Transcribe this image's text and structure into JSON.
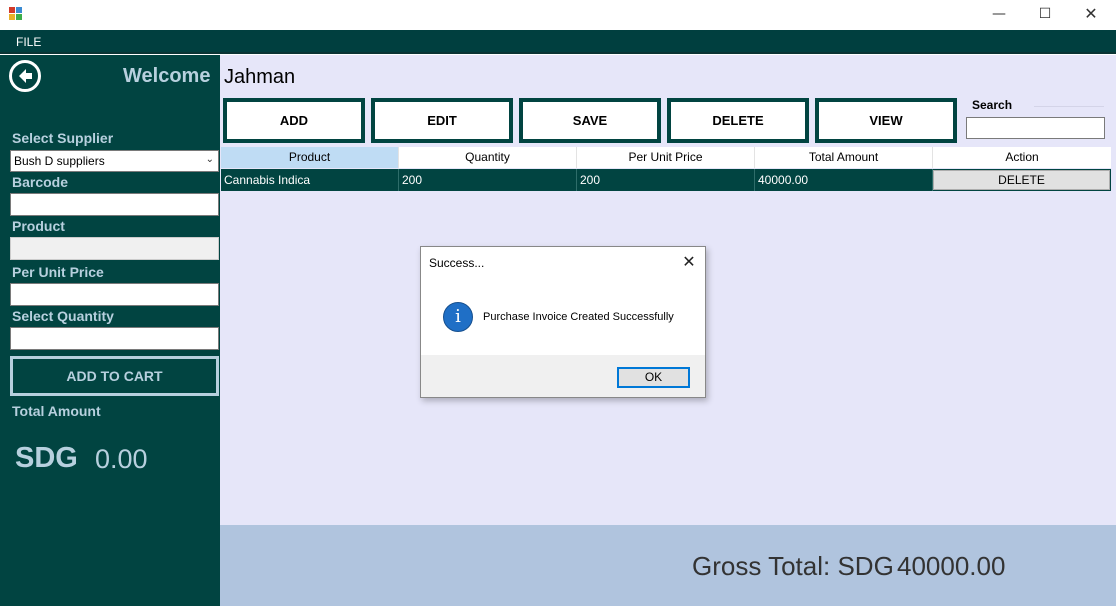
{
  "window": {
    "minimize_glyph": "—",
    "maximize_glyph": "☐",
    "close_glyph": "✕"
  },
  "menu": {
    "file": "FILE"
  },
  "sidebar": {
    "welcome": "Welcome",
    "select_supplier_label": "Select Supplier",
    "supplier_value": "Bush D suppliers",
    "barcode_label": "Barcode",
    "barcode_value": "",
    "product_label": "Product",
    "product_value": "",
    "unit_price_label": "Per Unit Price",
    "unit_price_value": "",
    "quantity_label": "Select Quantity",
    "quantity_value": "",
    "add_to_cart": "ADD TO CART",
    "total_amount_label": "Total Amount",
    "currency": "SDG",
    "total_amount": "0.00"
  },
  "main": {
    "username": "Jahman",
    "toolbar": {
      "add": "ADD",
      "edit": "EDIT",
      "save": "SAVE",
      "delete": "DELETE",
      "view": "VIEW"
    },
    "search_label": "Search",
    "search_value": ""
  },
  "grid": {
    "columns": [
      "Product",
      "Quantity",
      "Per Unit Price",
      "Total Amount",
      "Action"
    ],
    "rows": [
      {
        "product": "Cannabis Indica",
        "quantity": "200",
        "unit_price": "200",
        "total": "40000.00",
        "action": "DELETE"
      }
    ]
  },
  "footer": {
    "gross_label": "Gross Total: SDG",
    "gross_value": "40000.00"
  },
  "dialog": {
    "title": "Success...",
    "close_glyph": "✕",
    "message": "Purchase Invoice Created Successfully",
    "ok": "OK",
    "icon_glyph": "i"
  },
  "colors": {
    "sidebar_bg": "#014441",
    "sidebar_text": "#b7d0de",
    "main_bg": "#e6e6f9",
    "footer_bg": "#b0c4de",
    "row_selected_bg": "#014441",
    "header_active": "#bfdcf4",
    "info_icon": "#1f6fc6"
  }
}
